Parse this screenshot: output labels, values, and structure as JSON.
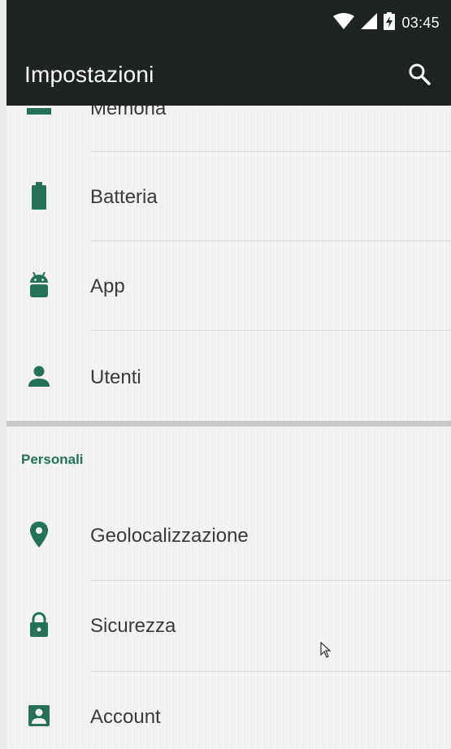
{
  "status_bar": {
    "time": "03:45",
    "icons": [
      "wifi-icon",
      "signal-icon",
      "battery-charging-icon"
    ]
  },
  "app_bar": {
    "title": "Impostazioni",
    "search_icon": "search-icon"
  },
  "settings": {
    "partial_item": {
      "label": "Memoria",
      "icon": "storage-icon"
    },
    "device_items": [
      {
        "label": "Batteria",
        "icon": "battery-icon"
      },
      {
        "label": "App",
        "icon": "android-icon"
      },
      {
        "label": "Utenti",
        "icon": "person-icon"
      }
    ],
    "personal_header": "Personali",
    "personal_items": [
      {
        "label": "Geolocalizzazione",
        "icon": "location-pin-icon"
      },
      {
        "label": "Sicurezza",
        "icon": "lock-icon"
      },
      {
        "label": "Account",
        "icon": "account-box-icon"
      }
    ]
  },
  "colors": {
    "accent": "#24725a",
    "bar": "#1f2321",
    "background": "#f3f3f1"
  }
}
